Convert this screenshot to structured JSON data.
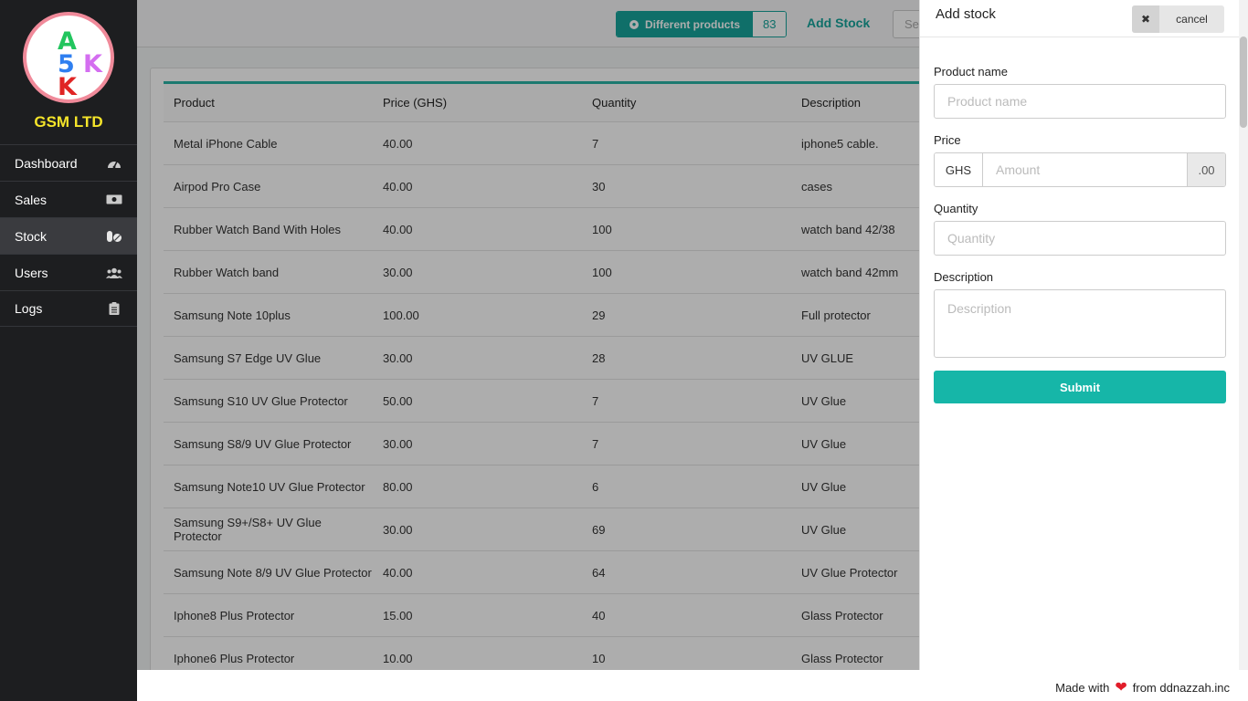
{
  "logo": {
    "letters": [
      "A",
      "5",
      "K",
      "K"
    ],
    "brand": "GSM LTD"
  },
  "nav": [
    {
      "label": "Dashboard",
      "icon": "speedometer-icon"
    },
    {
      "label": "Sales",
      "icon": "money-icon"
    },
    {
      "label": "Stock",
      "icon": "pills-icon",
      "active": true
    },
    {
      "label": "Users",
      "icon": "users-icon"
    },
    {
      "label": "Logs",
      "icon": "clipboard-icon"
    }
  ],
  "topbar": {
    "badge_label": "Different products",
    "badge_count": "83",
    "add_stock": "Add Stock",
    "search_placeholder": "Se"
  },
  "table": {
    "headers": [
      "Product",
      "Price (GHS)",
      "Quantity",
      "Description"
    ],
    "rows": [
      [
        "Metal iPhone Cable",
        "40.00",
        "7",
        "iphone5 cable."
      ],
      [
        "Airpod Pro Case",
        "40.00",
        "30",
        "cases"
      ],
      [
        "Rubber Watch Band With Holes",
        "40.00",
        "100",
        "watch band 42/38"
      ],
      [
        "Rubber Watch band",
        "30.00",
        "100",
        "watch band 42mm"
      ],
      [
        "Samsung Note 10plus",
        "100.00",
        "29",
        "Full protector"
      ],
      [
        "Samsung S7 Edge UV Glue",
        "30.00",
        "28",
        "UV GLUE"
      ],
      [
        "Samsung S10 UV Glue Protector",
        "50.00",
        "7",
        "UV Glue"
      ],
      [
        "Samsung S8/9 UV Glue Protector",
        "30.00",
        "7",
        "UV Glue"
      ],
      [
        "Samsung Note10 UV Glue Protector",
        "80.00",
        "6",
        "UV Glue"
      ],
      [
        "Samsung S9+/S8+ UV Glue Protector",
        "30.00",
        "69",
        "UV Glue"
      ],
      [
        "Samsung Note 8/9 UV Glue Protector",
        "40.00",
        "64",
        "UV Glue Protector"
      ],
      [
        "Iphone8 Plus Protector",
        "15.00",
        "40",
        "Glass Protector"
      ],
      [
        "Iphone6 Plus Protector",
        "10.00",
        "10",
        "Glass Protector"
      ]
    ]
  },
  "panel": {
    "title": "Add stock",
    "cancel": "cancel",
    "product_label": "Product name",
    "product_placeholder": "Product name",
    "price_label": "Price",
    "currency": "GHS",
    "amount_placeholder": "Amount",
    "decimals": ".00",
    "quantity_label": "Quantity",
    "quantity_placeholder": "Quantity",
    "description_label": "Description",
    "description_placeholder": "Description",
    "submit": "Submit"
  },
  "footer": {
    "made_with": "Made with",
    "from": "from ddnazzah.inc"
  },
  "colors": {
    "accent": "#17a49b",
    "sidebar": "#1d1e20",
    "brand": "#f5e52a",
    "heart": "#e11d2a"
  }
}
